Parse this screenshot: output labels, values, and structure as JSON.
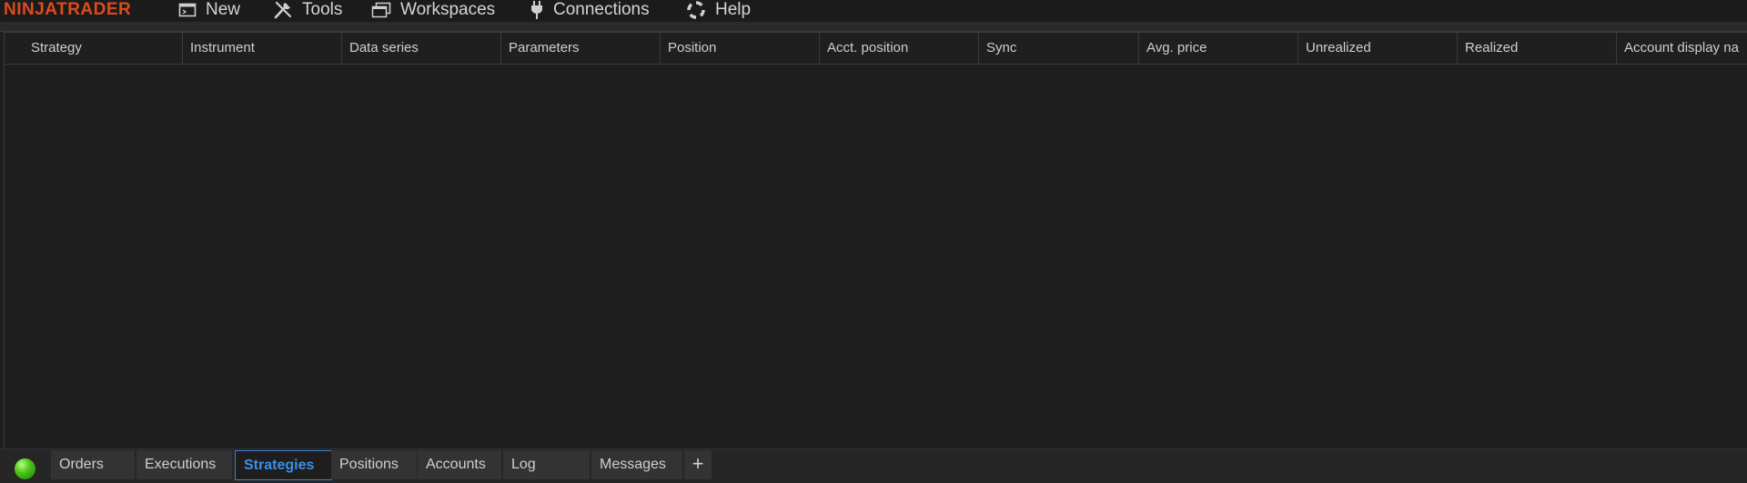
{
  "app": {
    "logo": "NINJATRADER"
  },
  "menu": {
    "new": "New",
    "tools": "Tools",
    "workspaces": "Workspaces",
    "connections": "Connections",
    "help": "Help"
  },
  "grid": {
    "columns": [
      "Strategy",
      "Instrument",
      "Data series",
      "Parameters",
      "Position",
      "Acct. position",
      "Sync",
      "Avg. price",
      "Unrealized",
      "Realized",
      "Account display na"
    ]
  },
  "tabs": {
    "orders": "Orders",
    "executions": "Executions",
    "strategies": "Strategies",
    "positions": "Positions",
    "accounts": "Accounts",
    "log": "Log",
    "messages": "Messages",
    "add": "+"
  },
  "colors": {
    "accent": "#3d8fe8",
    "logo": "#e04a1a",
    "status": "#4fc41d"
  },
  "icons": {
    "new": "new-window-icon",
    "tools": "tools-icon",
    "workspaces": "workspaces-icon",
    "connections": "plug-icon",
    "help": "lifebuoy-icon"
  }
}
